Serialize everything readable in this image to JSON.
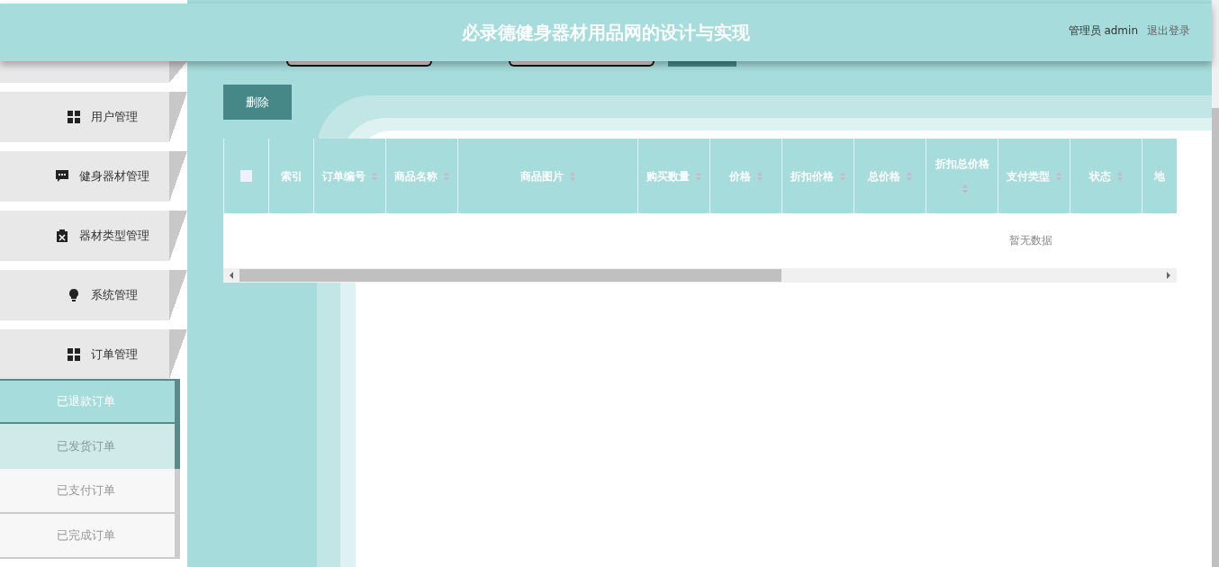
{
  "header": {
    "title": "必录德健身器材用品网的设计与实现",
    "user": "管理员 admin",
    "logout": "退出登录"
  },
  "sidebar": {
    "items": [
      {
        "label": "用户管理"
      },
      {
        "label": "健身器材管理"
      },
      {
        "label": "器材类型管理"
      },
      {
        "label": "系统管理"
      },
      {
        "label": "订单管理",
        "expanded": true,
        "children": [
          {
            "label": "已退款订单",
            "selected": true,
            "hovered": false
          },
          {
            "label": "已发货订单",
            "selected": false,
            "hovered": true
          },
          {
            "label": "已支付订单",
            "selected": false,
            "hovered": false
          },
          {
            "label": "已完成订单",
            "selected": false,
            "hovered": false
          }
        ]
      }
    ]
  },
  "toolbar": {
    "delete_button": "删除"
  },
  "table": {
    "select_all": {
      "checked": false
    },
    "columns": [
      {
        "label": "索引",
        "sortable": false
      },
      {
        "label": "订单编号",
        "sortable": true
      },
      {
        "label": "商品名称",
        "sortable": true
      },
      {
        "label": "商品图片",
        "sortable": true
      },
      {
        "label": "购买数量",
        "sortable": true
      },
      {
        "label": "价格",
        "sortable": true
      },
      {
        "label": "折扣价格",
        "sortable": true
      },
      {
        "label": "总价格",
        "sortable": true
      },
      {
        "label": "折扣总价格",
        "sortable": true
      },
      {
        "label": "支付类型",
        "sortable": true
      },
      {
        "label": "状态",
        "sortable": true
      },
      {
        "label": "地",
        "sortable": false
      }
    ],
    "empty_text": "暂无数据"
  }
}
